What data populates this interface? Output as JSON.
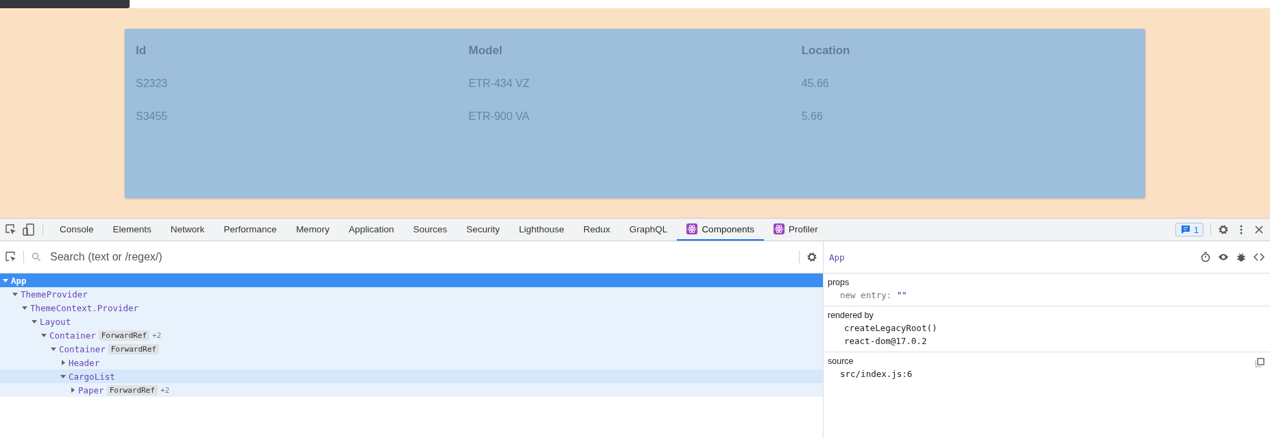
{
  "page": {
    "table": {
      "columns": [
        "Id",
        "Model",
        "Location"
      ],
      "rows": [
        [
          "S2323",
          "ETR-434 VZ",
          "45.66"
        ],
        [
          "S3455",
          "ETR-900 VA",
          "5.66"
        ]
      ]
    }
  },
  "devtools": {
    "tabs": [
      {
        "label": "Console",
        "kind": "plain",
        "selected": false
      },
      {
        "label": "Elements",
        "kind": "plain",
        "selected": false
      },
      {
        "label": "Network",
        "kind": "plain",
        "selected": false
      },
      {
        "label": "Performance",
        "kind": "plain",
        "selected": false
      },
      {
        "label": "Memory",
        "kind": "plain",
        "selected": false
      },
      {
        "label": "Application",
        "kind": "plain",
        "selected": false
      },
      {
        "label": "Sources",
        "kind": "plain",
        "selected": false
      },
      {
        "label": "Security",
        "kind": "plain",
        "selected": false
      },
      {
        "label": "Lighthouse",
        "kind": "plain",
        "selected": false
      },
      {
        "label": "Redux",
        "kind": "plain",
        "selected": false
      },
      {
        "label": "GraphQL",
        "kind": "plain",
        "selected": false
      },
      {
        "label": "Components",
        "kind": "react",
        "selected": true
      },
      {
        "label": "Profiler",
        "kind": "react",
        "selected": false
      }
    ],
    "message_count": "1",
    "search": {
      "placeholder": "Search (text or /regex/)"
    },
    "tree": [
      {
        "name": "App",
        "expanded": true,
        "selected": true,
        "highlighted": false,
        "children": [
          {
            "name": "ThemeProvider",
            "expanded": true,
            "selected": false,
            "highlighted": false,
            "children": [
              {
                "name": "ThemeContext.Provider",
                "expanded": true,
                "selected": false,
                "highlighted": false,
                "children": [
                  {
                    "name": "Layout",
                    "expanded": true,
                    "selected": false,
                    "highlighted": false,
                    "children": [
                      {
                        "name": "Container",
                        "badge": "ForwardRef",
                        "extra": "+2",
                        "expanded": true,
                        "selected": false,
                        "highlighted": false,
                        "children": [
                          {
                            "name": "Container",
                            "badge": "ForwardRef",
                            "expanded": true,
                            "selected": false,
                            "highlighted": false,
                            "children": [
                              {
                                "name": "Header",
                                "expanded": false,
                                "selected": false,
                                "highlighted": false
                              },
                              {
                                "name": "CargoList",
                                "expanded": true,
                                "selected": false,
                                "highlighted": true,
                                "children": [
                                  {
                                    "name": "Paper",
                                    "badge": "ForwardRef",
                                    "extra": "+2",
                                    "expanded": false,
                                    "selected": false,
                                    "highlighted": false
                                  }
                                ]
                              }
                            ]
                          }
                        ]
                      }
                    ]
                  }
                ]
              }
            ]
          }
        ]
      }
    ],
    "inspector": {
      "component": "App",
      "sections": [
        {
          "title": "props",
          "kind": "props",
          "lines": [
            {
              "key": "new entry:",
              "value": "\"\""
            }
          ]
        },
        {
          "title": "rendered by",
          "kind": "list",
          "lines": [
            "createLegacyRoot()",
            "react-dom@17.0.2"
          ]
        },
        {
          "title": "source",
          "kind": "source",
          "lines": [
            "src/index.js:6"
          ]
        }
      ]
    }
  }
}
